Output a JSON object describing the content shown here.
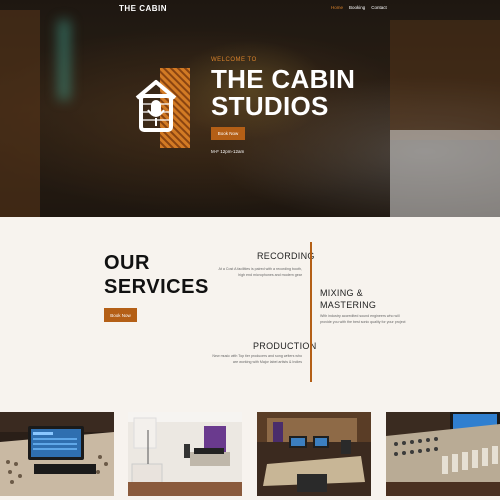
{
  "nav": {
    "brand": "THE CABIN",
    "links": [
      {
        "label": "Home",
        "active": true
      },
      {
        "label": "Booking",
        "active": false
      },
      {
        "label": "Contact",
        "active": false
      }
    ]
  },
  "hero": {
    "welcome": "WELCOME TO",
    "title_line1": "THE CABIN",
    "title_line2": "STUDIOS",
    "button": "Book Now",
    "hours": "M-F 12pm-12am"
  },
  "services": {
    "heading_line1": "OUR",
    "heading_line2": "SERVICES",
    "button": "Book Now",
    "items": [
      {
        "title": "RECORDING",
        "desc": "At a Cost A facilities is paired with a recording booth, high end microphones and modern gear"
      },
      {
        "title_line1": "MIXING &",
        "title_line2": "MASTERING",
        "desc": "With industry accredited sound engineers who will provide you with the best sonic quality for your project"
      },
      {
        "title": "PRODUCTION",
        "desc": "New music with Top tier producers and song writers who are working with Major label artists & Indies"
      }
    ]
  },
  "colors": {
    "accent": "#b45f16",
    "accent_text": "#d9822b",
    "background": "#f7f3ee"
  },
  "icons": [
    "house-microphone-logo"
  ]
}
